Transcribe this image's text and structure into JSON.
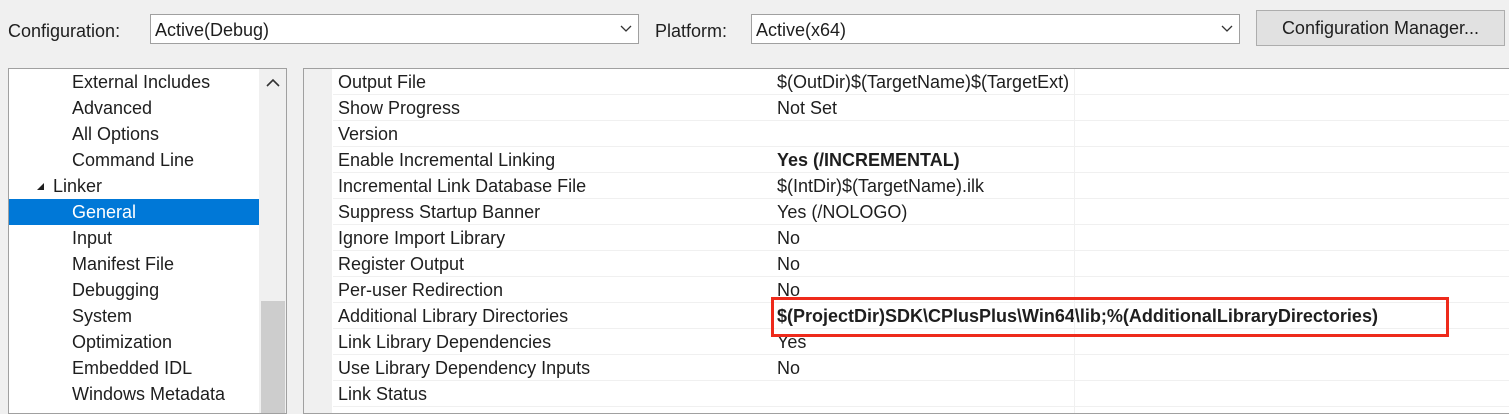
{
  "toolbar": {
    "configuration_label": "Configuration:",
    "configuration_value": "Active(Debug)",
    "platform_label": "Platform:",
    "platform_value": "Active(x64)",
    "config_manager_label": "Configuration Manager..."
  },
  "tree": {
    "items": [
      {
        "label": "External Includes",
        "level": 2
      },
      {
        "label": "Advanced",
        "level": 2
      },
      {
        "label": "All Options",
        "level": 2
      },
      {
        "label": "Command Line",
        "level": 2
      },
      {
        "label": "Linker",
        "level": 1,
        "expanded": true
      },
      {
        "label": "General",
        "level": 2,
        "selected": true
      },
      {
        "label": "Input",
        "level": 2
      },
      {
        "label": "Manifest File",
        "level": 2
      },
      {
        "label": "Debugging",
        "level": 2
      },
      {
        "label": "System",
        "level": 2
      },
      {
        "label": "Optimization",
        "level": 2
      },
      {
        "label": "Embedded IDL",
        "level": 2
      },
      {
        "label": "Windows Metadata",
        "level": 2
      }
    ]
  },
  "properties": [
    {
      "name": "Output File",
      "value": "$(OutDir)$(TargetName)$(TargetExt)",
      "bold": false
    },
    {
      "name": "Show Progress",
      "value": "Not Set",
      "bold": false
    },
    {
      "name": "Version",
      "value": "",
      "bold": false
    },
    {
      "name": "Enable Incremental Linking",
      "value": "Yes (/INCREMENTAL)",
      "bold": true
    },
    {
      "name": "Incremental Link Database File",
      "value": "$(IntDir)$(TargetName).ilk",
      "bold": false
    },
    {
      "name": "Suppress Startup Banner",
      "value": "Yes (/NOLOGO)",
      "bold": false
    },
    {
      "name": "Ignore Import Library",
      "value": "No",
      "bold": false
    },
    {
      "name": "Register Output",
      "value": "No",
      "bold": false
    },
    {
      "name": "Per-user Redirection",
      "value": "No",
      "bold": false
    },
    {
      "name": "Additional Library Directories",
      "value": "$(ProjectDir)SDK\\CPlusPlus\\Win64\\lib;%(AdditionalLibraryDirectories)",
      "bold": true
    },
    {
      "name": "Link Library Dependencies",
      "value": "Yes",
      "bold": false
    },
    {
      "name": "Use Library Dependency Inputs",
      "value": "No",
      "bold": false
    },
    {
      "name": "Link Status",
      "value": "",
      "bold": false
    }
  ],
  "colors": {
    "selection": "#0078d7",
    "highlight_box": "#ee2a1b",
    "background": "#f0f0f0"
  }
}
